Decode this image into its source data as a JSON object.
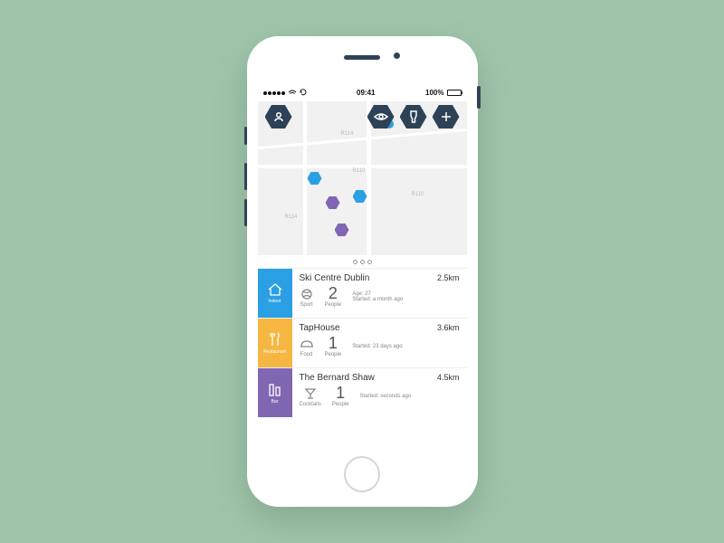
{
  "statusbar": {
    "carrier": "•••••",
    "time": "09:41",
    "battery": "100%"
  },
  "hex_buttons": {
    "profile": "profile",
    "eye": "eye",
    "filter": "filter",
    "add": "add"
  },
  "map": {
    "labels": [
      "R114",
      "R110",
      "R110",
      "R114"
    ]
  },
  "list": [
    {
      "category": "Indoor",
      "color": "blue",
      "title": "Ski Centre Dublin",
      "distance": "2.5km",
      "subtype": "Sport",
      "people": "2",
      "people_label": "People",
      "age": "Age: 27",
      "started": "Started: a month ago"
    },
    {
      "category": "Restaurant",
      "color": "yellow",
      "title": "TapHouse",
      "distance": "3.6km",
      "subtype": "Food",
      "people": "1",
      "people_label": "People",
      "age": "",
      "started": "Started: 23 days ago"
    },
    {
      "category": "Bar",
      "color": "purple",
      "title": "The Bernard Shaw",
      "distance": "4.5km",
      "subtype": "Cocktails",
      "people": "1",
      "people_label": "People",
      "age": "",
      "started": "Started: seconds ago"
    }
  ]
}
